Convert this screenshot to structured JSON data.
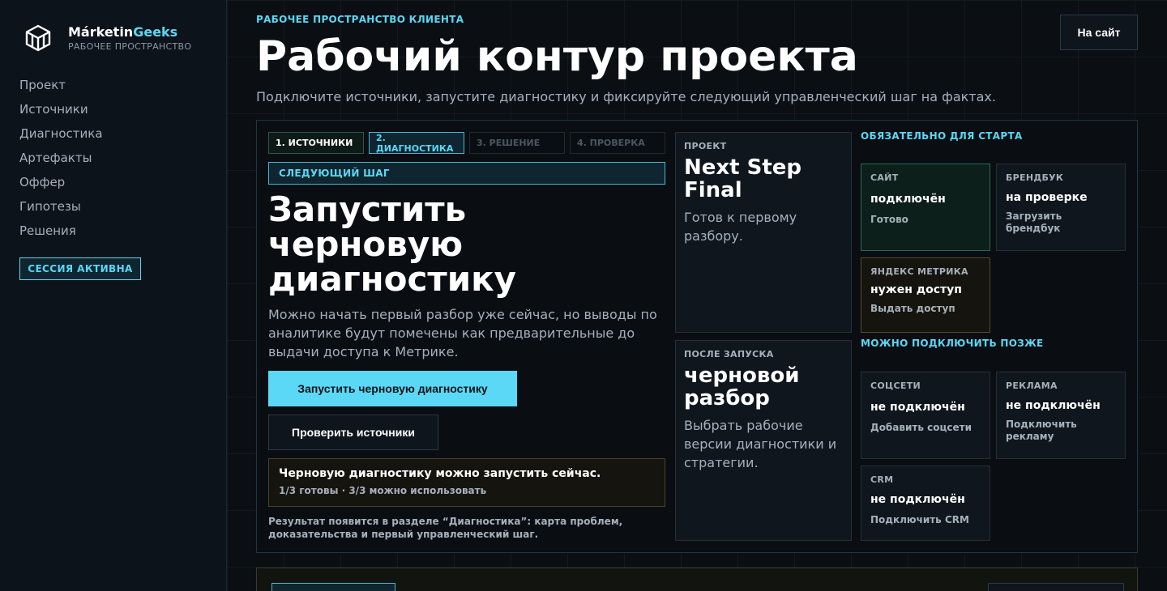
{
  "sidebar": {
    "brand_name_part1": "Márketin",
    "brand_name_part2": "Geeks",
    "brand_sub": "РАБОЧЕЕ ПРОСТРАНСТВО",
    "nav": [
      "Проект",
      "Источники",
      "Диагностика",
      "Артефакты",
      "Оффер",
      "Гипотезы",
      "Решения"
    ],
    "session_badge": "СЕССИЯ АКТИВНА"
  },
  "header": {
    "kicker": "РАБОЧЕЕ ПРОСТРАНСТВО КЛИЕНТА",
    "title": "Рабочий контур проекта",
    "subtitle": "Подключите источники, запустите диагностику и фиксируйте следующий управленческий шаг на фактах.",
    "site_button": "На сайт"
  },
  "steps": [
    "1. ИСТОЧНИКИ",
    "2. ДИАГНОСТИКА",
    "3. РЕШЕНИЕ",
    "4. ПРОВЕРКА"
  ],
  "next_step": {
    "label": "СЛЕДУЮЩИЙ ШАГ",
    "title": "Запустить черновую диагностику",
    "description": "Можно начать первый разбор уже сейчас, но выводы по аналитике будут помечены как предварительные до выдачи доступа к Метрике.",
    "primary_button": "Запустить черновую диагностику",
    "secondary_button": "Проверить источники",
    "notice_title": "Черновую диагностику можно запустить сейчас.",
    "notice_sub": "1/3 готовы · 3/3 можно использовать",
    "result_note": "Результат появится в разделе “Диагностика”: карта проблем, доказательства и первый управленческий шаг."
  },
  "project_card": {
    "label": "ПРОЕКТ",
    "name": "Next Step Final",
    "description": "Готов к первому разбору."
  },
  "after_launch_card": {
    "label": "ПОСЛЕ ЗАПУСКА",
    "name": "черновой разбор",
    "description": "Выбрать рабочие версии диагностики и стратегии."
  },
  "required": {
    "heading": "ОБЯЗАТЕЛЬНО ДЛЯ СТАРТА",
    "items": [
      {
        "label": "САЙТ",
        "status": "подключён",
        "action": "Готово"
      },
      {
        "label": "БРЕНДБУК",
        "status": "на проверке",
        "action": "Загрузить брендбук"
      },
      {
        "label": "ЯНДЕКС МЕТРИКА",
        "status": "нужен доступ",
        "action": "Выдать доступ"
      }
    ]
  },
  "later": {
    "heading": "МОЖНО ПОДКЛЮЧИТЬ ПОЗЖЕ",
    "items": [
      {
        "label": "СОЦСЕТИ",
        "status": "не подключён",
        "action": "Добавить соцсети"
      },
      {
        "label": "РЕКЛАМА",
        "status": "не подключён",
        "action": "Подключить рекламу"
      },
      {
        "label": "CRM",
        "status": "не подключён",
        "action": "Подключить CRM"
      }
    ]
  },
  "colors": {
    "accent": "#5ad8f5",
    "background": "#0b0f14",
    "ok": "#2b6a50",
    "warn": "#5a4a25"
  },
  "icons": {
    "logo": "cube-logo-icon"
  }
}
